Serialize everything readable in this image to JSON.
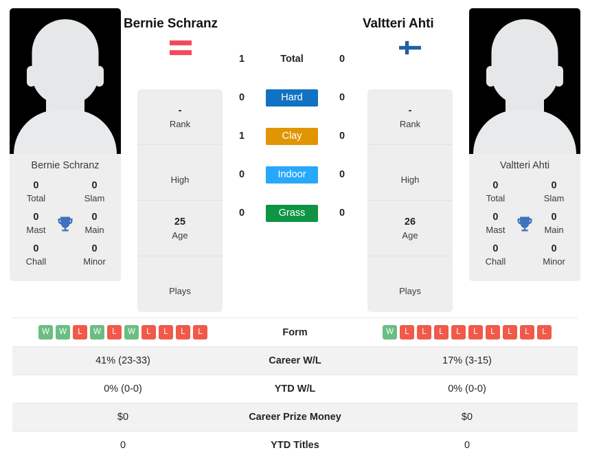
{
  "players": {
    "left": {
      "name": "Bernie Schranz",
      "flag": "austria-flag",
      "rank": "-",
      "rank_label": "Rank",
      "high": "",
      "high_label": "High",
      "age": "25",
      "age_label": "Age",
      "plays": "",
      "plays_label": "Plays",
      "titles": {
        "total": "0",
        "total_label": "Total",
        "slam": "0",
        "slam_label": "Slam",
        "mast": "0",
        "mast_label": "Mast",
        "main": "0",
        "main_label": "Main",
        "chall": "0",
        "chall_label": "Chall",
        "minor": "0",
        "minor_label": "Minor"
      },
      "form": [
        "W",
        "W",
        "L",
        "W",
        "L",
        "W",
        "L",
        "L",
        "L",
        "L"
      ],
      "career_wl": "41% (23-33)",
      "ytd_wl": "0% (0-0)",
      "career_prize": "$0",
      "ytd_titles": "0"
    },
    "right": {
      "name": "Valtteri Ahti",
      "flag": "finland-flag",
      "rank": "-",
      "rank_label": "Rank",
      "high": "",
      "high_label": "High",
      "age": "26",
      "age_label": "Age",
      "plays": "",
      "plays_label": "Plays",
      "titles": {
        "total": "0",
        "total_label": "Total",
        "slam": "0",
        "slam_label": "Slam",
        "mast": "0",
        "mast_label": "Mast",
        "main": "0",
        "main_label": "Main",
        "chall": "0",
        "chall_label": "Chall",
        "minor": "0",
        "minor_label": "Minor"
      },
      "form": [
        "W",
        "L",
        "L",
        "L",
        "L",
        "L",
        "L",
        "L",
        "L",
        "L"
      ],
      "career_wl": "17% (3-15)",
      "ytd_wl": "0% (0-0)",
      "career_prize": "$0",
      "ytd_titles": "0"
    }
  },
  "h2h": {
    "total": {
      "label": "Total",
      "left": "1",
      "right": "0"
    },
    "surfaces": [
      {
        "label": "Hard",
        "left": "0",
        "right": "0",
        "color": "#1172c2"
      },
      {
        "label": "Clay",
        "left": "1",
        "right": "0",
        "color": "#e09503"
      },
      {
        "label": "Indoor",
        "left": "0",
        "right": "0",
        "color": "#27a8fb"
      },
      {
        "label": "Grass",
        "left": "0",
        "right": "0",
        "color": "#0e9444"
      }
    ]
  },
  "table": {
    "form_label": "Form",
    "rows": [
      {
        "label": "Career W/L",
        "left": "41% (23-33)",
        "right": "17% (3-15)"
      },
      {
        "label": "YTD W/L",
        "left": "0% (0-0)",
        "right": "0% (0-0)"
      },
      {
        "label": "Career Prize Money",
        "left": "$0",
        "right": "$0"
      },
      {
        "label": "YTD Titles",
        "left": "0",
        "right": "0"
      }
    ]
  },
  "colors": {
    "win": "#6abe82",
    "loss": "#f05a4a",
    "panel": "#eeeeee",
    "stripe": "#f2f2f2",
    "trophy": "#3f72bd"
  }
}
